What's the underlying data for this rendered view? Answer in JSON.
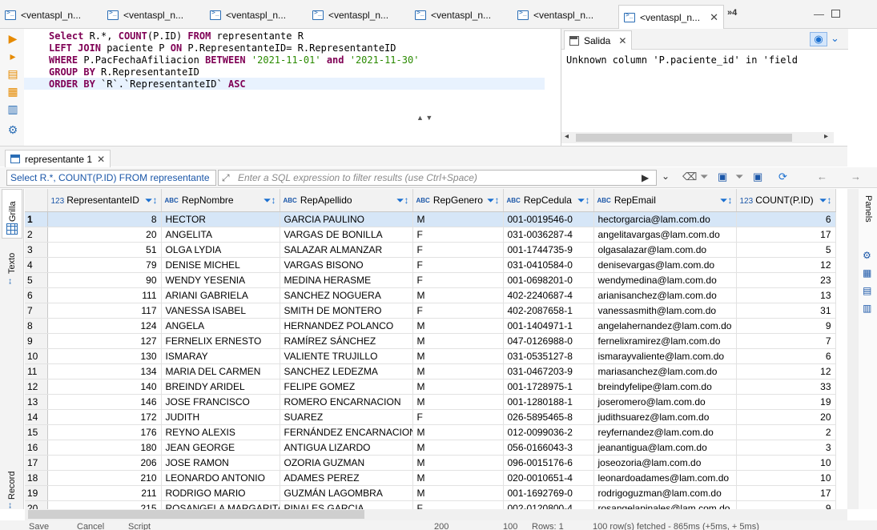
{
  "tabs": [
    {
      "label": "<ventaspl_n...",
      "active": false
    },
    {
      "label": "<ventaspl_n...",
      "active": false
    },
    {
      "label": "<ventaspl_n...",
      "active": false
    },
    {
      "label": "<ventaspl_n...",
      "active": false
    },
    {
      "label": "<ventaspl_n...",
      "active": false
    },
    {
      "label": "<ventaspl_n...",
      "active": false
    },
    {
      "label": "<ventaspl_n...",
      "active": true
    }
  ],
  "tab_overflow": "»4",
  "sql_lines": [
    {
      "kw1": "Select",
      "t1": " R.*, ",
      "kw2": "COUNT",
      "t2": "(P.ID) ",
      "kw3": "FROM",
      "t3": " representante R"
    },
    {
      "kw1": "LEFT JOIN",
      "t1": " paciente P ",
      "kw2": "ON",
      "t2": " P.RepresentanteID= R.RepresentanteID",
      "kw3": "",
      "t3": ""
    },
    {
      "kw1": "WHERE",
      "t1": " P.PacFechaAfiliacion ",
      "kw2": "BETWEEN",
      "t2": " ",
      "s1": "'2021-11-01'",
      "kw3": " and ",
      "s2": "'2021-11-30'"
    },
    {
      "kw1": "GROUP BY",
      "t1": " R.RepresentanteID",
      "kw2": "",
      "t2": "",
      "kw3": "",
      "t3": ""
    },
    {
      "kw1": "ORDER BY",
      "t1": " `R`.`RepresentanteID` ",
      "kw2": "ASC",
      "t2": "",
      "kw3": "",
      "t3": ""
    }
  ],
  "output": {
    "tab_label": "Salida",
    "message": "Unknown column 'P.paciente_id' in 'field"
  },
  "results_tab_label": "representante 1",
  "filter": {
    "sql_preview": "Select R.*, COUNT(P.ID) FROM representante",
    "placeholder": "Enter a SQL expression to filter results (use Ctrl+Space)"
  },
  "side_tabs": {
    "grid": "Grilla",
    "text": "Texto",
    "record": "Record"
  },
  "right_tabs": {
    "panels": "Panels"
  },
  "columns": [
    {
      "name": "RepresentanteID",
      "type": "123"
    },
    {
      "name": "RepNombre",
      "type": "ABC"
    },
    {
      "name": "RepApellido",
      "type": "ABC"
    },
    {
      "name": "RepGenero",
      "type": "ABC"
    },
    {
      "name": "RepCedula",
      "type": "ABC"
    },
    {
      "name": "RepEmail",
      "type": "ABC"
    },
    {
      "name": "COUNT(P.ID)",
      "type": "123"
    }
  ],
  "rows": [
    [
      1,
      8,
      "HECTOR",
      "GARCIA PAULINO",
      "M",
      "001-0019546-0",
      "hectorgarcia@lam.com.do",
      6
    ],
    [
      2,
      20,
      "ANGELITA",
      "VARGAS DE BONILLA",
      "F",
      "031-0036287-4",
      "angelitavargas@lam.com.do",
      17
    ],
    [
      3,
      51,
      "OLGA LYDIA",
      "SALAZAR ALMANZAR",
      "F",
      "001-1744735-9",
      "olgasalazar@lam.com.do",
      5
    ],
    [
      4,
      79,
      "DENISE MICHEL",
      "VARGAS BISONO",
      "F",
      "031-0410584-0",
      "denisevargas@lam.com.do",
      12
    ],
    [
      5,
      90,
      "WENDY YESENIA",
      "MEDINA HERASME",
      "F",
      "001-0698201-0",
      "wendymedina@lam.com.do",
      23
    ],
    [
      6,
      111,
      "ARIANI GABRIELA",
      "SANCHEZ NOGUERA",
      "M",
      "402-2240687-4",
      "arianisanchez@lam.com.do",
      13
    ],
    [
      7,
      117,
      "VANESSA ISABEL",
      "SMITH DE MONTERO",
      "F",
      "402-2087658-1",
      "vanessasmith@lam.com.do",
      31
    ],
    [
      8,
      124,
      "ANGELA",
      "HERNANDEZ POLANCO",
      "M",
      "001-1404971-1",
      "angelahernandez@lam.com.do",
      9
    ],
    [
      9,
      127,
      "FERNELIX ERNESTO",
      "RAMÍREZ SÁNCHEZ",
      "M",
      "047-0126988-0",
      "fernelixramirez@lam.com.do",
      7
    ],
    [
      10,
      130,
      "ISMARAY",
      "VALIENTE TRUJILLO",
      "M",
      "031-0535127-8",
      "ismarayvaliente@lam.com.do",
      6
    ],
    [
      11,
      134,
      "MARIA DEL CARMEN",
      "SANCHEZ LEDEZMA",
      "M",
      "031-0467203-9",
      "mariasanchez@lam.com.do",
      12
    ],
    [
      12,
      140,
      "BREINDY ARIDEL",
      "FELIPE GOMEZ",
      "M",
      "001-1728975-1",
      "breindyfelipe@lam.com.do",
      33
    ],
    [
      13,
      146,
      "JOSE FRANCISCO",
      "ROMERO ENCARNACION",
      "M",
      "001-1280188-1",
      "joseromero@lam.com.do",
      19
    ],
    [
      14,
      172,
      "JUDITH",
      "SUAREZ",
      "F",
      "026-5895465-8",
      "judithsuarez@lam.com.do",
      20
    ],
    [
      15,
      176,
      "REYNO ALEXIS",
      "FERNÁNDEZ ENCARNACION",
      "M",
      "012-0099036-2",
      "reyfernandez@lam.com.do",
      2
    ],
    [
      16,
      180,
      "JEAN GEORGE",
      "ANTIGUA LIZARDO",
      "M",
      "056-0166043-3",
      "jeanantigua@lam.com.do",
      3
    ],
    [
      17,
      206,
      "JOSE RAMON",
      "OZORIA GUZMAN",
      "M",
      "096-0015176-6",
      "joseozoria@lam.com.do",
      10
    ],
    [
      18,
      210,
      "LEONARDO ANTONIO",
      "ADAMES PEREZ",
      "M",
      "020-0010651-4",
      "leonardoadames@lam.com.do",
      10
    ],
    [
      19,
      211,
      "RODRIGO MARIO",
      "GUZMÁN LAGOMBRA",
      "M",
      "001-1692769-0",
      "rodrigoguzman@lam.com.do",
      17
    ],
    [
      20,
      215,
      "ROSANGELA MARGARITA",
      "PINALES GARCIA",
      "F",
      "002-0120800-4",
      "rosangelapinales@lam.com.do",
      9
    ]
  ],
  "status": {
    "save": "Save",
    "cancel": "Cancel",
    "script": "Script",
    "fetch_size": "200",
    "rows_count": "100",
    "rows_label": "Rows: 1",
    "fetched": "100 row(s) fetched - 865ms (+5ms, + 5ms)"
  },
  "colors": {
    "accent": "#1a6fd0",
    "keyword": "#7f0055",
    "string": "#2a8a00",
    "selection": "#d6e6f7"
  }
}
